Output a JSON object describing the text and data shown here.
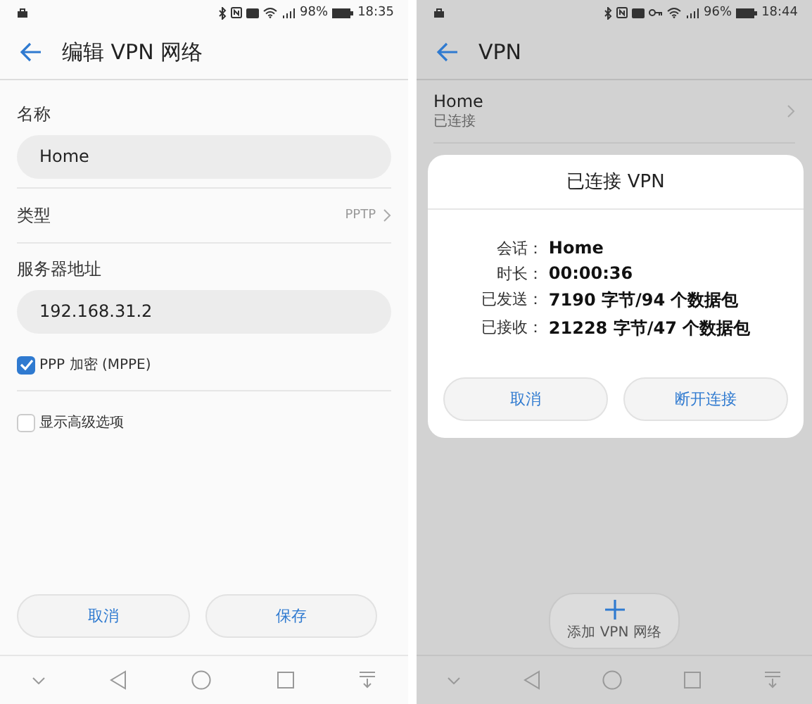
{
  "screens": [
    {
      "status_bar": {
        "vpn_key": false,
        "battery": "98%",
        "time": "18:35"
      },
      "header": {
        "title": "编辑 VPN 网络"
      },
      "form": [
        {
          "kind": "text",
          "label": "名称",
          "value": "Home"
        },
        {
          "kind": "select",
          "label": "类型",
          "value": "PPTP"
        },
        {
          "kind": "text",
          "label": "服务器地址",
          "value": "192.168.31.2"
        },
        {
          "kind": "checkbox",
          "label": "PPP 加密 (MPPE)",
          "checked": true
        },
        {
          "kind": "checkbox",
          "label": "显示高级选项",
          "checked": false
        }
      ],
      "buttons": [
        "取消",
        "保存"
      ]
    },
    {
      "status_bar": {
        "vpn_key": true,
        "battery": "96%",
        "time": "18:44"
      },
      "header": {
        "title": "VPN"
      },
      "vpn_list": [
        {
          "name": "Home",
          "status": "已连接"
        }
      ],
      "dialog": {
        "title": "已连接 VPN",
        "rows": [
          {
            "label": "会话：",
            "value": "Home"
          },
          {
            "label": "时长：",
            "value": "00:00:36"
          },
          {
            "label": "已发送：",
            "value": "7190 字节/94 个数据包"
          },
          {
            "label": "已接收：",
            "value": "21228 字节/47 个数据包"
          }
        ],
        "buttons": [
          "取消",
          "断开连接"
        ]
      },
      "add_button": {
        "label": "添加 VPN 网络"
      }
    }
  ]
}
